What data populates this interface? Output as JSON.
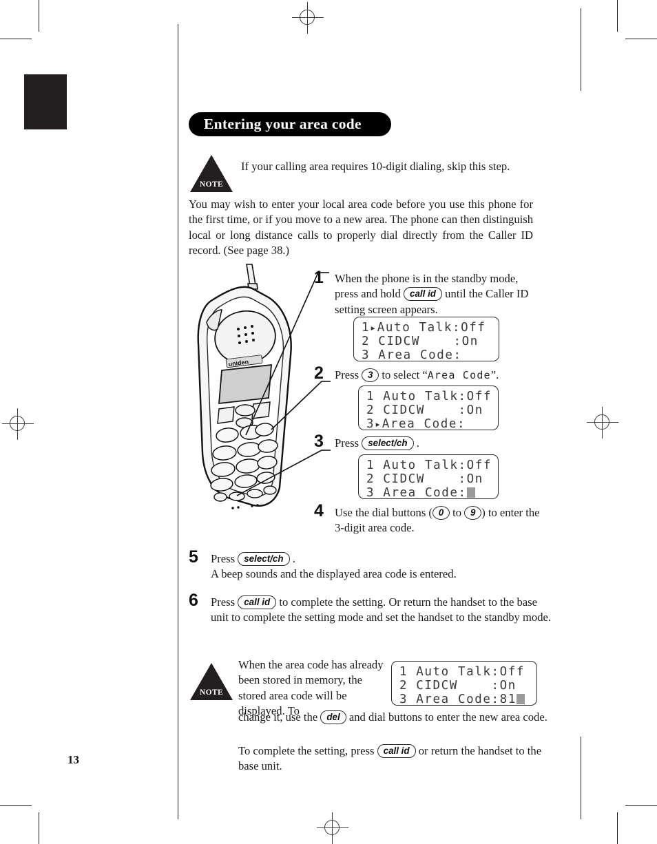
{
  "page": {
    "number": "13"
  },
  "section": {
    "title": "Entering your area code"
  },
  "note_top": {
    "badge": "NOTE",
    "text": "If your calling area requires 10-digit dialing, skip this step."
  },
  "intro": {
    "text": "You may wish to enter your local area code before you use this phone for the first time, or if you move to a new area. The phone can then distinguish local or long distance calls to properly dial directly from the Caller ID record. (See page 38.)"
  },
  "steps": [
    {
      "number": "1",
      "text_before": "When the phone is in the standby mode, press and hold",
      "key": "call id",
      "text_after": "until the Caller ID setting screen appears."
    },
    {
      "number": "2",
      "text_before": "Press",
      "key": "3",
      "text_mid": "to select “",
      "lcd_word": "Area Code",
      "text_after": "”."
    },
    {
      "number": "3",
      "text_before": "Press",
      "key": "select/ch",
      "text_after": "."
    },
    {
      "number": "4",
      "text_before": "Use the dial buttons (",
      "key_low": "0",
      "text_mid": "to",
      "key_high": "9",
      "text_after": ") to enter the 3-digit area code."
    },
    {
      "number": "5",
      "text_before": "Press",
      "key": "select/ch",
      "text_after": ".",
      "text_second_line": "A beep sounds and the displayed area code is entered."
    },
    {
      "number": "6",
      "text_before": "Press",
      "key": "call id",
      "text_after": "to complete the setting. Or return the handset to the base unit to complete the setting mode and set the handset to the standby mode."
    }
  ],
  "lcd_screens": {
    "step1": {
      "line1_num": "1",
      "line1_cursor": "▸",
      "line1_text": "Auto Talk:Off",
      "line2": "2 CIDCW    :On",
      "line3": "3 Area Code:"
    },
    "step2": {
      "line1": "1 Auto Talk:Off",
      "line2": "2 CIDCW    :On",
      "line3_num": "3",
      "line3_cursor": "▸",
      "line3_text": "Area Code:"
    },
    "step3": {
      "line1": "1 Auto Talk:Off",
      "line2": "2 CIDCW    :On",
      "line3_text": "3 Area Code:",
      "line3_cursor_block": true
    },
    "note_bottom": {
      "line1": "1 Auto Talk:Off",
      "line2": "2 CIDCW    :On",
      "line3_text": "3 Area Code:81",
      "line3_cursor_block": true
    }
  },
  "note_bottom": {
    "badge": "NOTE",
    "para1_a": "When the area code has already been stored in memory, the stored area code will be displayed. To",
    "para1_b_before": "change it, use the",
    "para1_key": "del",
    "para1_b_after": "and dial buttons to enter the new area code.",
    "para2_before": "To complete the setting, press",
    "para2_key": "call id",
    "para2_after": "or return the handset to the base unit."
  },
  "illustration": {
    "device_label": "uniden",
    "alt": "cordless-phone-handset"
  }
}
